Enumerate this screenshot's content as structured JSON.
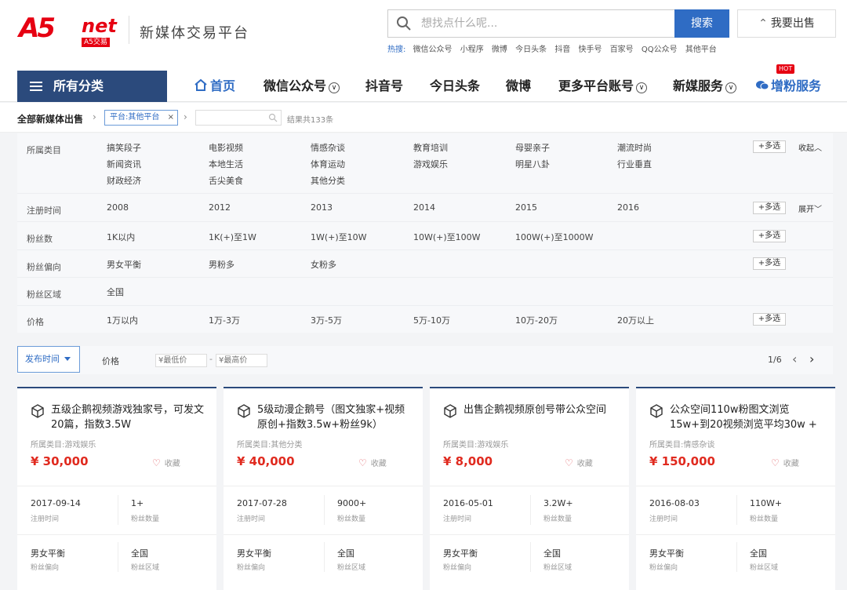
{
  "header": {
    "logo_main": "A5",
    "logo_net": "net",
    "logo_sub": "A5交易",
    "site_name": "新媒体交易平台",
    "search_placeholder": "想找点什么呢...",
    "search_button": "搜索",
    "sell_button": "我要出售",
    "hot_label": "热搜:",
    "hot_words": [
      "微信公众号",
      "小程序",
      "微博",
      "今日头条",
      "抖音",
      "快手号",
      "百家号",
      "QQ公众号",
      "其他平台"
    ]
  },
  "nav": {
    "all_categories": "所有分类",
    "items": [
      {
        "label": "首页",
        "active": true
      },
      {
        "label": "微信公众号",
        "dropdown": true
      },
      {
        "label": "抖音号"
      },
      {
        "label": "今日头条"
      },
      {
        "label": "微博"
      },
      {
        "label": "更多平台账号",
        "dropdown": true
      },
      {
        "label": "新媒服务",
        "dropdown": true
      },
      {
        "label": "增粉服务",
        "hot": true
      }
    ],
    "hot_badge": "HOT"
  },
  "breadcrumb": {
    "root": "全部新媒体出售",
    "tag": "平台:其他平台",
    "tag_close": "×",
    "result": "结果共133条"
  },
  "filters": {
    "multi_label": "+多选",
    "collapse_label": "收起",
    "expand_label": "展开",
    "rows": [
      {
        "label": "所属类目",
        "options": [
          "搞笑段子",
          "电影视频",
          "情感杂谈",
          "教育培训",
          "母婴亲子",
          "潮流时尚",
          "新闻资讯",
          "本地生活",
          "体育运动",
          "游戏娱乐",
          "明星八卦",
          "行业垂直",
          "财政经济",
          "舌尖美食",
          "其他分类"
        ]
      },
      {
        "label": "注册时间",
        "options": [
          "2008",
          "2012",
          "2013",
          "2014",
          "2015",
          "2016"
        ]
      },
      {
        "label": "粉丝数",
        "options": [
          "1K以内",
          "1K(+)至1W",
          "1W(+)至10W",
          "10W(+)至100W",
          "100W(+)至1000W"
        ]
      },
      {
        "label": "粉丝偏向",
        "options": [
          "男女平衡",
          "男粉多",
          "女粉多"
        ]
      },
      {
        "label": "粉丝区域",
        "options": [
          "全国"
        ]
      },
      {
        "label": "价格",
        "options": [
          "1万以内",
          "1万-3万",
          "3万-5万",
          "5万-10万",
          "10万-20万",
          "20万以上"
        ]
      }
    ]
  },
  "sortbar": {
    "sort_label": "发布时间",
    "price_label": "价格",
    "min_placeholder": "¥最低价",
    "max_placeholder": "¥最高价",
    "dash": "-",
    "page": "1/6"
  },
  "cards": [
    {
      "title": "五级企鹅视频游戏独家号，可发文20篇，指数3.5W",
      "category": "所属类目:游戏娱乐",
      "price": "¥ 30,000",
      "fav": "收藏",
      "reg_date": "2017-09-14",
      "reg_label": "注册时间",
      "fans": "1+",
      "fans_label": "粉丝数量",
      "bias": "男女平衡",
      "bias_label": "粉丝偏向",
      "region": "全国",
      "region_label": "粉丝区域"
    },
    {
      "title": "5级动漫企鹅号（图文独家+视频原创+指数3.5w+粉丝9k）",
      "category": "所属类目:其他分类",
      "price": "¥ 40,000",
      "fav": "收藏",
      "reg_date": "2017-07-28",
      "reg_label": "注册时间",
      "fans": "9000+",
      "fans_label": "粉丝数量",
      "bias": "男女平衡",
      "bias_label": "粉丝偏向",
      "region": "全国",
      "region_label": "粉丝区域"
    },
    {
      "title": "出售企鹅视频原创号带公众空间",
      "category": "所属类目:游戏娱乐",
      "price": "¥ 8,000",
      "fav": "收藏",
      "reg_date": "2016-05-01",
      "reg_label": "注册时间",
      "fans": "3.2W+",
      "fans_label": "粉丝数量",
      "bias": "男女平衡",
      "bias_label": "粉丝偏向",
      "region": "全国",
      "region_label": "粉丝区域"
    },
    {
      "title": "公众空间110w粉图文浏览15w+到20视频浏览平均30w +",
      "category": "所属类目:情感杂谈",
      "price": "¥ 150,000",
      "fav": "收藏",
      "reg_date": "2016-08-03",
      "reg_label": "注册时间",
      "fans": "110W+",
      "fans_label": "粉丝数量",
      "bias": "男女平衡",
      "bias_label": "粉丝偏向",
      "region": "全国",
      "region_label": "粉丝区域"
    }
  ],
  "colors": {
    "brand_red": "#e60012",
    "primary_blue": "#2f6cc4",
    "nav_dark": "#2b4a7c",
    "price_red": "#e02a1f"
  }
}
